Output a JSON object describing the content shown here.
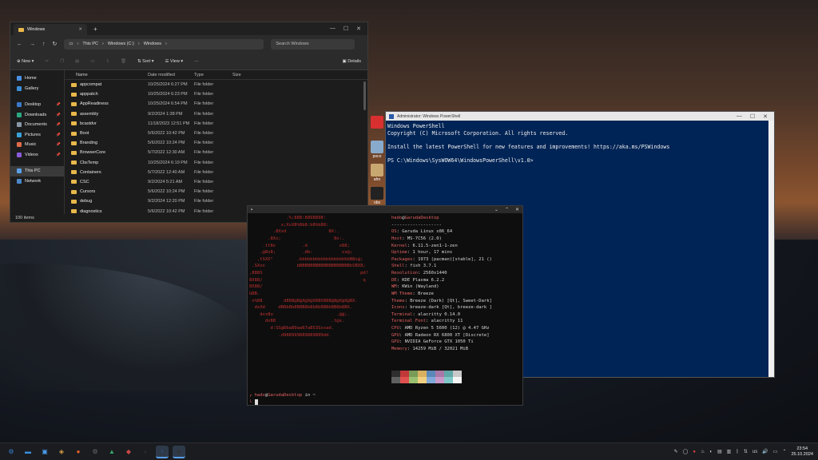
{
  "explorer": {
    "tab_title": "Windows",
    "breadcrumb": [
      "This PC",
      "Windows (C:)",
      "Windows"
    ],
    "search_placeholder": "Search Windows",
    "toolbar": {
      "new_label": "New",
      "sort_label": "Sort",
      "view_label": "View",
      "more_label": "···",
      "details_label": "Details"
    },
    "sidebar_top": [
      "Home",
      "Gallery"
    ],
    "sidebar_quick": [
      "Desktop",
      "Downloads",
      "Documents",
      "Pictures",
      "Music",
      "Videos"
    ],
    "sidebar_bottom": [
      "This PC",
      "Network"
    ],
    "columns": {
      "name": "Name",
      "date": "Date modified",
      "type": "Type",
      "size": "Size"
    },
    "rows": [
      {
        "name": "appcompat",
        "date": "10/25/2024 6:27 PM",
        "type": "File folder"
      },
      {
        "name": "apppatch",
        "date": "10/25/2024 6:23 PM",
        "type": "File folder"
      },
      {
        "name": "AppReadiness",
        "date": "10/25/2024 6:54 PM",
        "type": "File folder"
      },
      {
        "name": "assembly",
        "date": "9/2/2024 1:38 PM",
        "type": "File folder"
      },
      {
        "name": "bcastdvr",
        "date": "11/18/2023 12:51 PM",
        "type": "File folder"
      },
      {
        "name": "Boot",
        "date": "5/6/2022 10:42 PM",
        "type": "File folder"
      },
      {
        "name": "Branding",
        "date": "5/6/2022 10:24 PM",
        "type": "File folder"
      },
      {
        "name": "BrowserCore",
        "date": "5/7/2022 12:30 AM",
        "type": "File folder"
      },
      {
        "name": "CbsTemp",
        "date": "10/25/2024 6:19 PM",
        "type": "File folder"
      },
      {
        "name": "Containers",
        "date": "5/7/2022 12:40 AM",
        "type": "File folder"
      },
      {
        "name": "CSC",
        "date": "9/2/2024 5:21 AM",
        "type": "File folder"
      },
      {
        "name": "Cursors",
        "date": "5/6/2022 10:24 PM",
        "type": "File folder"
      },
      {
        "name": "debug",
        "date": "9/2/2024 12:20 PM",
        "type": "File folder"
      },
      {
        "name": "diagnostics",
        "date": "5/6/2022 10:42 PM",
        "type": "File folder"
      }
    ],
    "status": "100 items"
  },
  "powershell": {
    "title": "Administrator: Windows PowerShell",
    "lines": [
      "Windows PowerShell",
      "Copyright (C) Microsoft Corporation. All rights reserved.",
      "",
      "Install the latest PowerShell for new features and improvements! https://aka.ms/PSWindows",
      "",
      "PS C:\\Windows\\SysWOW64\\WindowsPowerShell\\v1.0>"
    ]
  },
  "desktop_icons": [
    {
      "label": "",
      "color": "#d83030",
      "top": 0
    },
    {
      "label": "poco",
      "color": "#88aacc",
      "top": 0
    },
    {
      "label": "afro",
      "color": "#c8a870",
      "top": 0
    },
    {
      "label": "obs",
      "color": "#222222",
      "top": 0
    }
  ],
  "terminal": {
    "ascii": [
      "              .%;888:8898898:",
      "            x;XxX8%8b8:b8%b88:",
      "         .8Xxd                8X:.",
      "       .8Xx;                    8x:.",
      "     .tt8x          .d            x88;",
      "    .@8x8;          .db:           xx@;",
      "   ,tSXX°         .bbbbbbbbbbbbbbbbbbbB8x@;",
      " .SXxx            bBBBBBBBBBBBBBBBBBBBbSBX8;",
      ",888S                                     pd!",
      "8X88/                                      q",
      "8X88/",
      "GBB.",
      " x%88        d888@8@X@X@X88X888@8@X@X@8X.",
      "  dxXd     dB8b8b8B8B8b8b8b8B8b8B8b8BX.",
      "    dxx8o                        .@@;.",
      "      dx88                     .t@x.",
      "        d:SS@8ba89aa67a853Sxxad.",
      "           .d988999889889899dd."
    ],
    "user": "hado",
    "host": "GarudaDesktop",
    "separator": "-------------------",
    "info": [
      {
        "k": "OS",
        "v": "Garuda Linux x86_64"
      },
      {
        "k": "Host",
        "v": "MS-7C56 (2.0)"
      },
      {
        "k": "Kernel",
        "v": "6.11.5-zen1-1-zen"
      },
      {
        "k": "Uptime",
        "v": "1 hour, 17 mins"
      },
      {
        "k": "Packages",
        "v": "1973 (pacman)[stable], 21 ()"
      },
      {
        "k": "Shell",
        "v": "fish 3.7.1"
      },
      {
        "k": "Resolution",
        "v": "2560x1440"
      },
      {
        "k": "DE",
        "v": "KDE Plasma 6.2.2"
      },
      {
        "k": "WM",
        "v": "KWin (Wayland)"
      },
      {
        "k": "WM Theme",
        "v": "Breeze"
      },
      {
        "k": "Theme",
        "v": "Breeze (Dark) [Qt], Sweet-Dark]"
      },
      {
        "k": "Icons",
        "v": "breeze-dark [Qt], breeze-dark ]"
      },
      {
        "k": "Terminal",
        "v": "alacritty 0.14.0"
      },
      {
        "k": "Terminal Font",
        "v": "alacritty 11"
      },
      {
        "k": "CPU",
        "v": "AMD Ryzen 5 5600 (12) @ 4.47 GHz"
      },
      {
        "k": "GPU",
        "v": "AMD Radeon RX 6800 XT [Discrete]"
      },
      {
        "k": "GPU",
        "v": "NVIDIA GeForce GTX 1050 Ti"
      },
      {
        "k": "Memory",
        "v": "14259 MiB / 32021 MiB"
      }
    ],
    "palette": [
      "#2e2e2e",
      "#c03838",
      "#7a9a58",
      "#d8b060",
      "#5a88b8",
      "#a878a8",
      "#60a8a8",
      "#c8c8c8",
      "#606060",
      "#e05050",
      "#98c070",
      "#f0d080",
      "#80a8d8",
      "#c898c8",
      "#80c8c8",
      "#f4f4f4"
    ],
    "prompt_user": "hado",
    "prompt_host": "GarudaDesktop",
    "prompt_dir": "in ~"
  },
  "taskbar": {
    "apps": [
      {
        "name": "launcher",
        "glyph": "⚙",
        "color": "#3a7fd0"
      },
      {
        "name": "files",
        "glyph": "▬",
        "color": "#3a8fe0"
      },
      {
        "name": "dolphin",
        "glyph": "▣",
        "color": "#4a9be8"
      },
      {
        "name": "store",
        "glyph": "◈",
        "color": "#d8a048"
      },
      {
        "name": "firefox",
        "glyph": "●",
        "color": "#e8602a"
      },
      {
        "name": "settings",
        "glyph": "⚙",
        "color": "#6a6a6a"
      },
      {
        "name": "monitor",
        "glyph": "▲",
        "color": "#3aa86a"
      },
      {
        "name": "dragon",
        "glyph": "◆",
        "color": "#c84848"
      },
      {
        "name": "terminal",
        "glyph": "›",
        "color": "#444444"
      },
      {
        "name": "powershell",
        "glyph": "›",
        "color": "#2a5aa8"
      },
      {
        "name": "alacritty",
        "glyph": "▲",
        "color": "#333333"
      }
    ],
    "tray": {
      "lang": "us",
      "time": "23:54",
      "date": "25.10.2024"
    }
  }
}
